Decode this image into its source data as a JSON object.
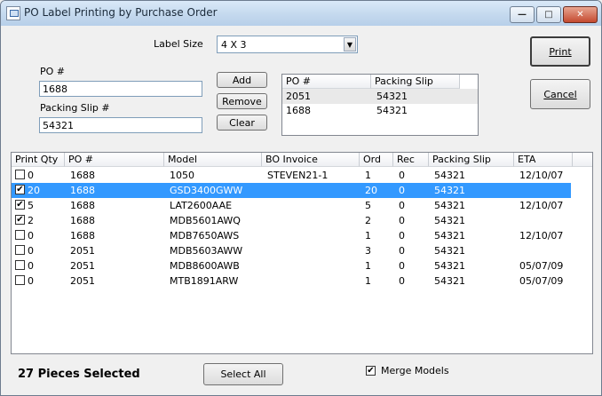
{
  "window": {
    "title": "PO Label Printing by Purchase Order",
    "min_glyph": "—",
    "max_glyph": "□",
    "close_glyph": "✕"
  },
  "form": {
    "label_size_label": "Label Size",
    "label_size_value": "4 X 3",
    "po_label": "PO #",
    "po_value": "1688",
    "packing_slip_label": "Packing Slip #",
    "packing_slip_value": "54321",
    "add_label": "Add",
    "remove_label": "Remove",
    "clear_label": "Clear"
  },
  "po_list": {
    "headers": [
      "PO #",
      "Packing Slip"
    ],
    "rows": [
      {
        "po": "2051",
        "slip": "54321"
      },
      {
        "po": "1688",
        "slip": "54321"
      }
    ]
  },
  "buttons": {
    "print_label": "Print",
    "cancel_label": "Cancel",
    "select_all_label": "Select All"
  },
  "grid": {
    "headers": [
      "Print Qty",
      "PO #",
      "Model",
      "BO Invoice",
      "Ord",
      "Rec",
      "Packing Slip",
      "ETA"
    ],
    "rows": [
      {
        "checked": false,
        "qty": "0",
        "po": "1688",
        "model": "1050",
        "bo": "STEVEN21-1",
        "ord": "1",
        "rec": "0",
        "slip": "54321",
        "eta": "12/10/07",
        "selected": false
      },
      {
        "checked": true,
        "qty": "20",
        "po": "1688",
        "model": "GSD3400GWW",
        "bo": "",
        "ord": "20",
        "rec": "0",
        "slip": "54321",
        "eta": "",
        "selected": true
      },
      {
        "checked": true,
        "qty": "5",
        "po": "1688",
        "model": "LAT2600AAE",
        "bo": "",
        "ord": "5",
        "rec": "0",
        "slip": "54321",
        "eta": "12/10/07",
        "selected": false
      },
      {
        "checked": true,
        "qty": "2",
        "po": "1688",
        "model": "MDB5601AWQ",
        "bo": "",
        "ord": "2",
        "rec": "0",
        "slip": "54321",
        "eta": "",
        "selected": false
      },
      {
        "checked": false,
        "qty": "0",
        "po": "1688",
        "model": "MDB7650AWS",
        "bo": "",
        "ord": "1",
        "rec": "0",
        "slip": "54321",
        "eta": "12/10/07",
        "selected": false
      },
      {
        "checked": false,
        "qty": "0",
        "po": "2051",
        "model": "MDB5603AWW",
        "bo": "",
        "ord": "3",
        "rec": "0",
        "slip": "54321",
        "eta": "",
        "selected": false
      },
      {
        "checked": false,
        "qty": "0",
        "po": "2051",
        "model": "MDB8600AWB",
        "bo": "",
        "ord": "1",
        "rec": "0",
        "slip": "54321",
        "eta": "05/07/09",
        "selected": false
      },
      {
        "checked": false,
        "qty": "0",
        "po": "2051",
        "model": "MTB1891ARW",
        "bo": "",
        "ord": "1",
        "rec": "0",
        "slip": "54321",
        "eta": "05/07/09",
        "selected": false
      }
    ]
  },
  "footer": {
    "pieces_selected": "27 Pieces Selected",
    "merge_models_label": "Merge Models",
    "merge_models_checked": true
  },
  "colors": {
    "selection": "#3399ff"
  }
}
